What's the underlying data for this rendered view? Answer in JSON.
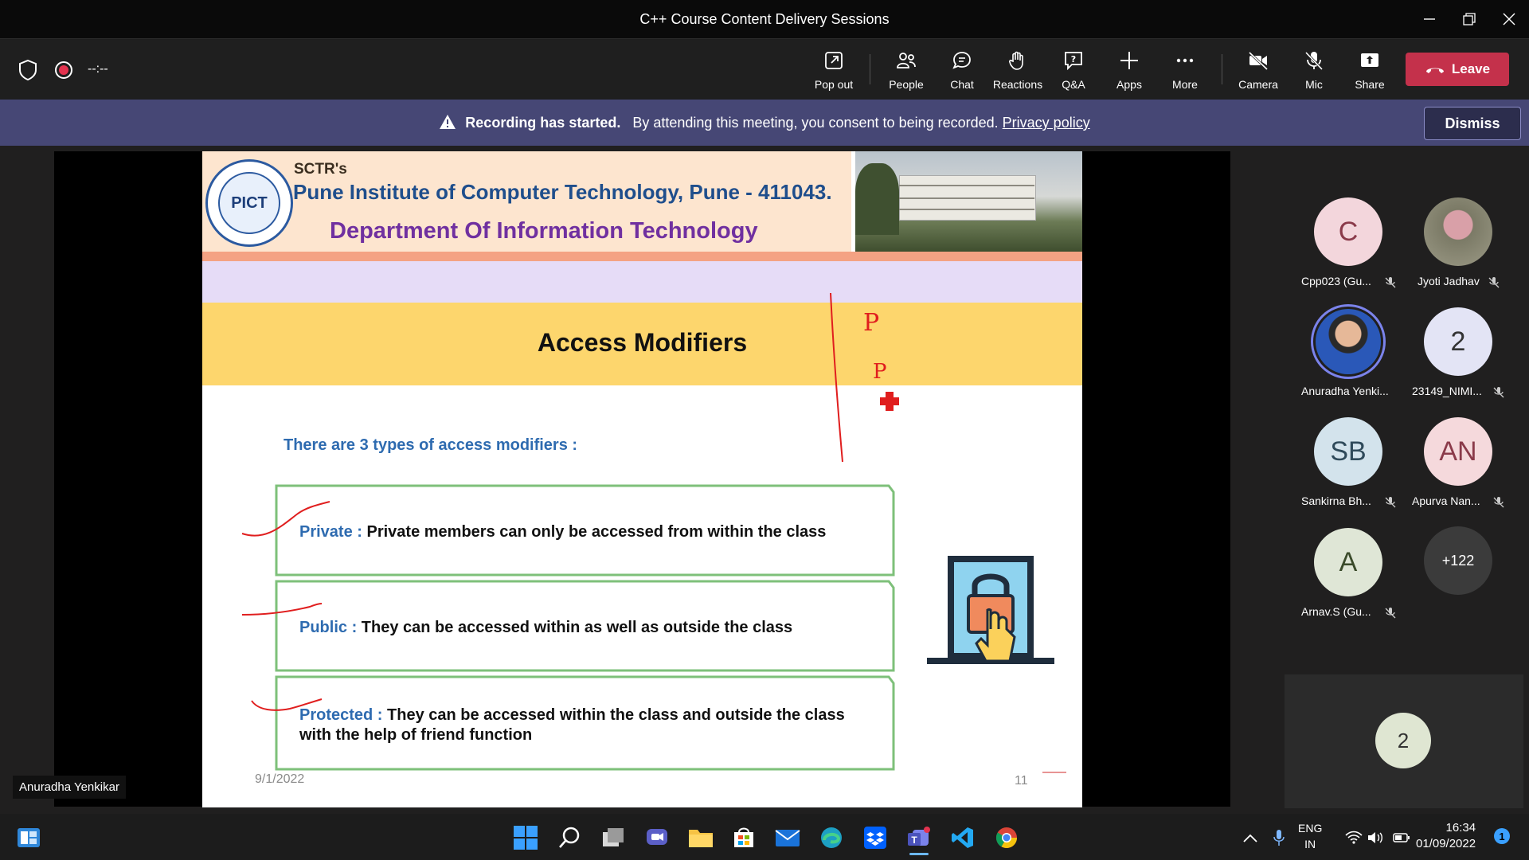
{
  "window": {
    "title": "C++ Course Content Delivery Sessions"
  },
  "toolbar": {
    "timer": "--:--",
    "buttons": [
      {
        "label": "Pop out"
      },
      {
        "label": "People"
      },
      {
        "label": "Chat"
      },
      {
        "label": "Reactions"
      },
      {
        "label": "Q&A"
      },
      {
        "label": "Apps"
      },
      {
        "label": "More"
      },
      {
        "label": "Camera"
      },
      {
        "label": "Mic"
      },
      {
        "label": "Share"
      }
    ],
    "leave_label": "Leave"
  },
  "banner": {
    "title": "Recording has started.",
    "message": "By attending this meeting, you consent to being recorded.",
    "link": "Privacy policy",
    "dismiss_label": "Dismiss"
  },
  "slide": {
    "brand": "SCTR's",
    "institute": "Pune Institute of Computer Technology, Pune - 411043.",
    "department": "Department Of Information Technology",
    "logo_text": "PICT",
    "heading": "Access Modifiers",
    "intro": "There are 3 types of access modifiers :",
    "items": [
      {
        "term": "Private :",
        "desc": "Private members can only be accessed from within the class"
      },
      {
        "term": "Public :",
        "desc": "They can be accessed within as well as outside the class"
      },
      {
        "term": "Protected :",
        "desc": "They can be accessed within the class and outside the class with the help of friend function"
      }
    ],
    "date": "9/1/2022",
    "page": "11",
    "annotations": [
      "P",
      "P"
    ]
  },
  "presenter_label": "Anuradha Yenkikar",
  "participants": [
    {
      "initials": "C",
      "name": "Cpp023 (Gu...",
      "color": "#f3d6dc",
      "text_color": "#8a3a4a",
      "muted": true
    },
    {
      "initials": "",
      "name": "Jyoti Jadhav",
      "color": "#8c8a7a",
      "text_color": "#fff",
      "muted": true
    },
    {
      "initials": "",
      "name": "Anuradha Yenki...",
      "color": "#6a6fc5",
      "text_color": "#fff",
      "muted": false
    },
    {
      "initials": "2",
      "name": "23149_NIMI...",
      "color": "#e3e4f5",
      "text_color": "#333",
      "muted": true
    },
    {
      "initials": "SB",
      "name": "Sankirna Bh...",
      "color": "#d3e3ec",
      "text_color": "#2f4a5a",
      "muted": true
    },
    {
      "initials": "AN",
      "name": "Apurva Nan...",
      "color": "#f5d9dc",
      "text_color": "#8a3a4a",
      "muted": true
    },
    {
      "initials": "A",
      "name": "Arnav.S (Gu...",
      "color": "#dfe6d6",
      "text_color": "#3a4a2a",
      "muted": true
    },
    {
      "initials": "+122",
      "name": "",
      "color": "#3b3b3b",
      "text_color": "#fff",
      "muted": false
    }
  ],
  "spotlight": {
    "count": "2"
  },
  "taskbar": {
    "icons": [
      "windows-start-icon",
      "search-icon",
      "task-view-icon",
      "chat-icon",
      "file-explorer-icon",
      "store-icon",
      "mail-icon",
      "edge-icon",
      "dropbox-icon",
      "teams-icon",
      "vscode-icon",
      "chrome-icon"
    ],
    "lang_top": "ENG",
    "lang_bottom": "IN",
    "time": "16:34",
    "date": "01/09/2022",
    "notifications": "1"
  }
}
